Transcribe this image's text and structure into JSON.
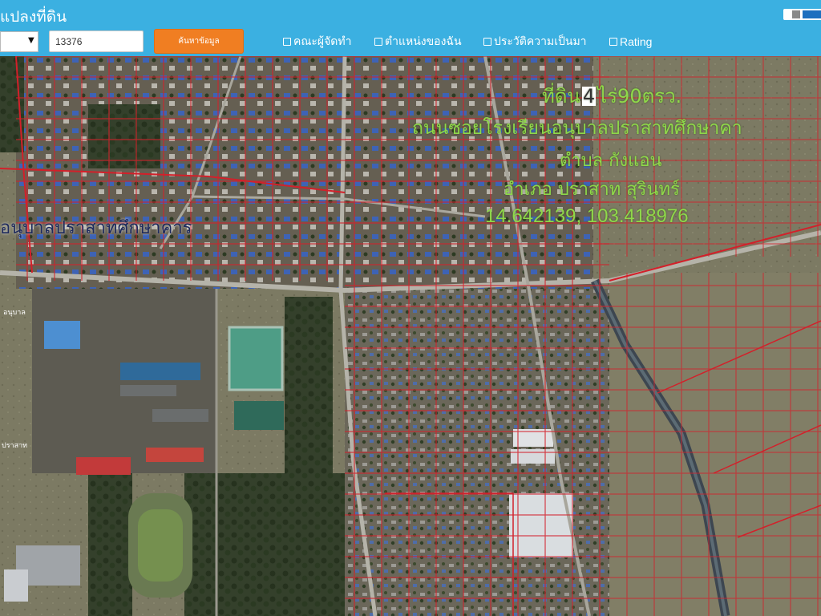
{
  "header": {
    "title": "แปลงที่ดิน",
    "select_value": "",
    "search_input_value": "13376",
    "search_button_label": "ค้นหาข้อมูล",
    "checkboxes": [
      {
        "label": "คณะผู้จัดทำ",
        "checked": false
      },
      {
        "label": "ตำแหน่งของฉัน",
        "checked": false
      },
      {
        "label": "ประวัติความเป็นมา",
        "checked": false
      },
      {
        "label": "Rating",
        "checked": false
      }
    ],
    "colors": {
      "bar": "#3bb0e1",
      "button": "#f07e22"
    }
  },
  "map": {
    "type": "satellite",
    "parcel_line_color": "#d3202a",
    "overlay": {
      "area_prefix": "ที่ดิน",
      "area_rai": "4",
      "area_suffix": "ไร่90ตรว.",
      "road": "ถนนซอยโรงเรียนอนุบาลปราสาทศึกษาคา",
      "subdistrict": "ตำบล กังแอน",
      "district_province": "อำเภอ ปราสาท สุรินทร์",
      "coordinates": "14.642139, 103.418976",
      "place_label": "อนุบาลปราสาทศึกษาคาร"
    },
    "small_labels": [
      "ปราสาท",
      "อนุบาล"
    ]
  }
}
